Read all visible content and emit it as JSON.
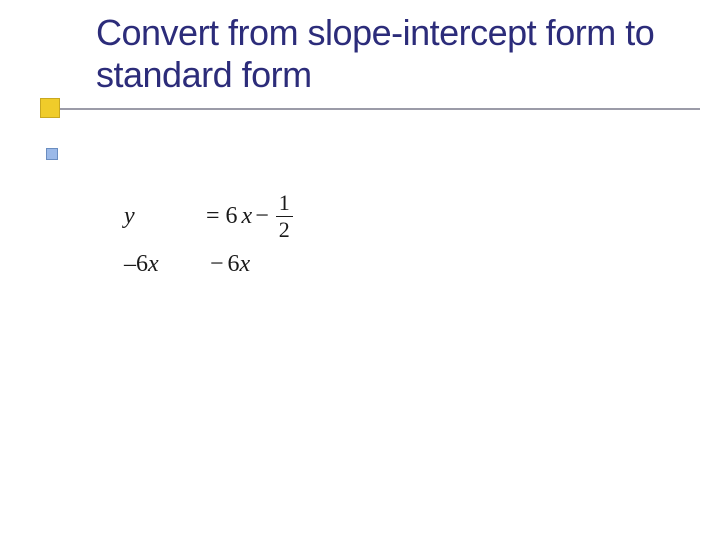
{
  "slide": {
    "title": "Convert from slope-intercept form to standard form"
  },
  "math": {
    "row1": {
      "y": "y",
      "eq": "=",
      "coef": "6",
      "xvar": "x",
      "minus": "−",
      "frac_num": "1",
      "frac_den": "2"
    },
    "row2": {
      "left_sign": "–",
      "left_coef": "6",
      "left_x": "x",
      "right_sign": "−",
      "right_coef": "6",
      "right_x": "x"
    }
  }
}
